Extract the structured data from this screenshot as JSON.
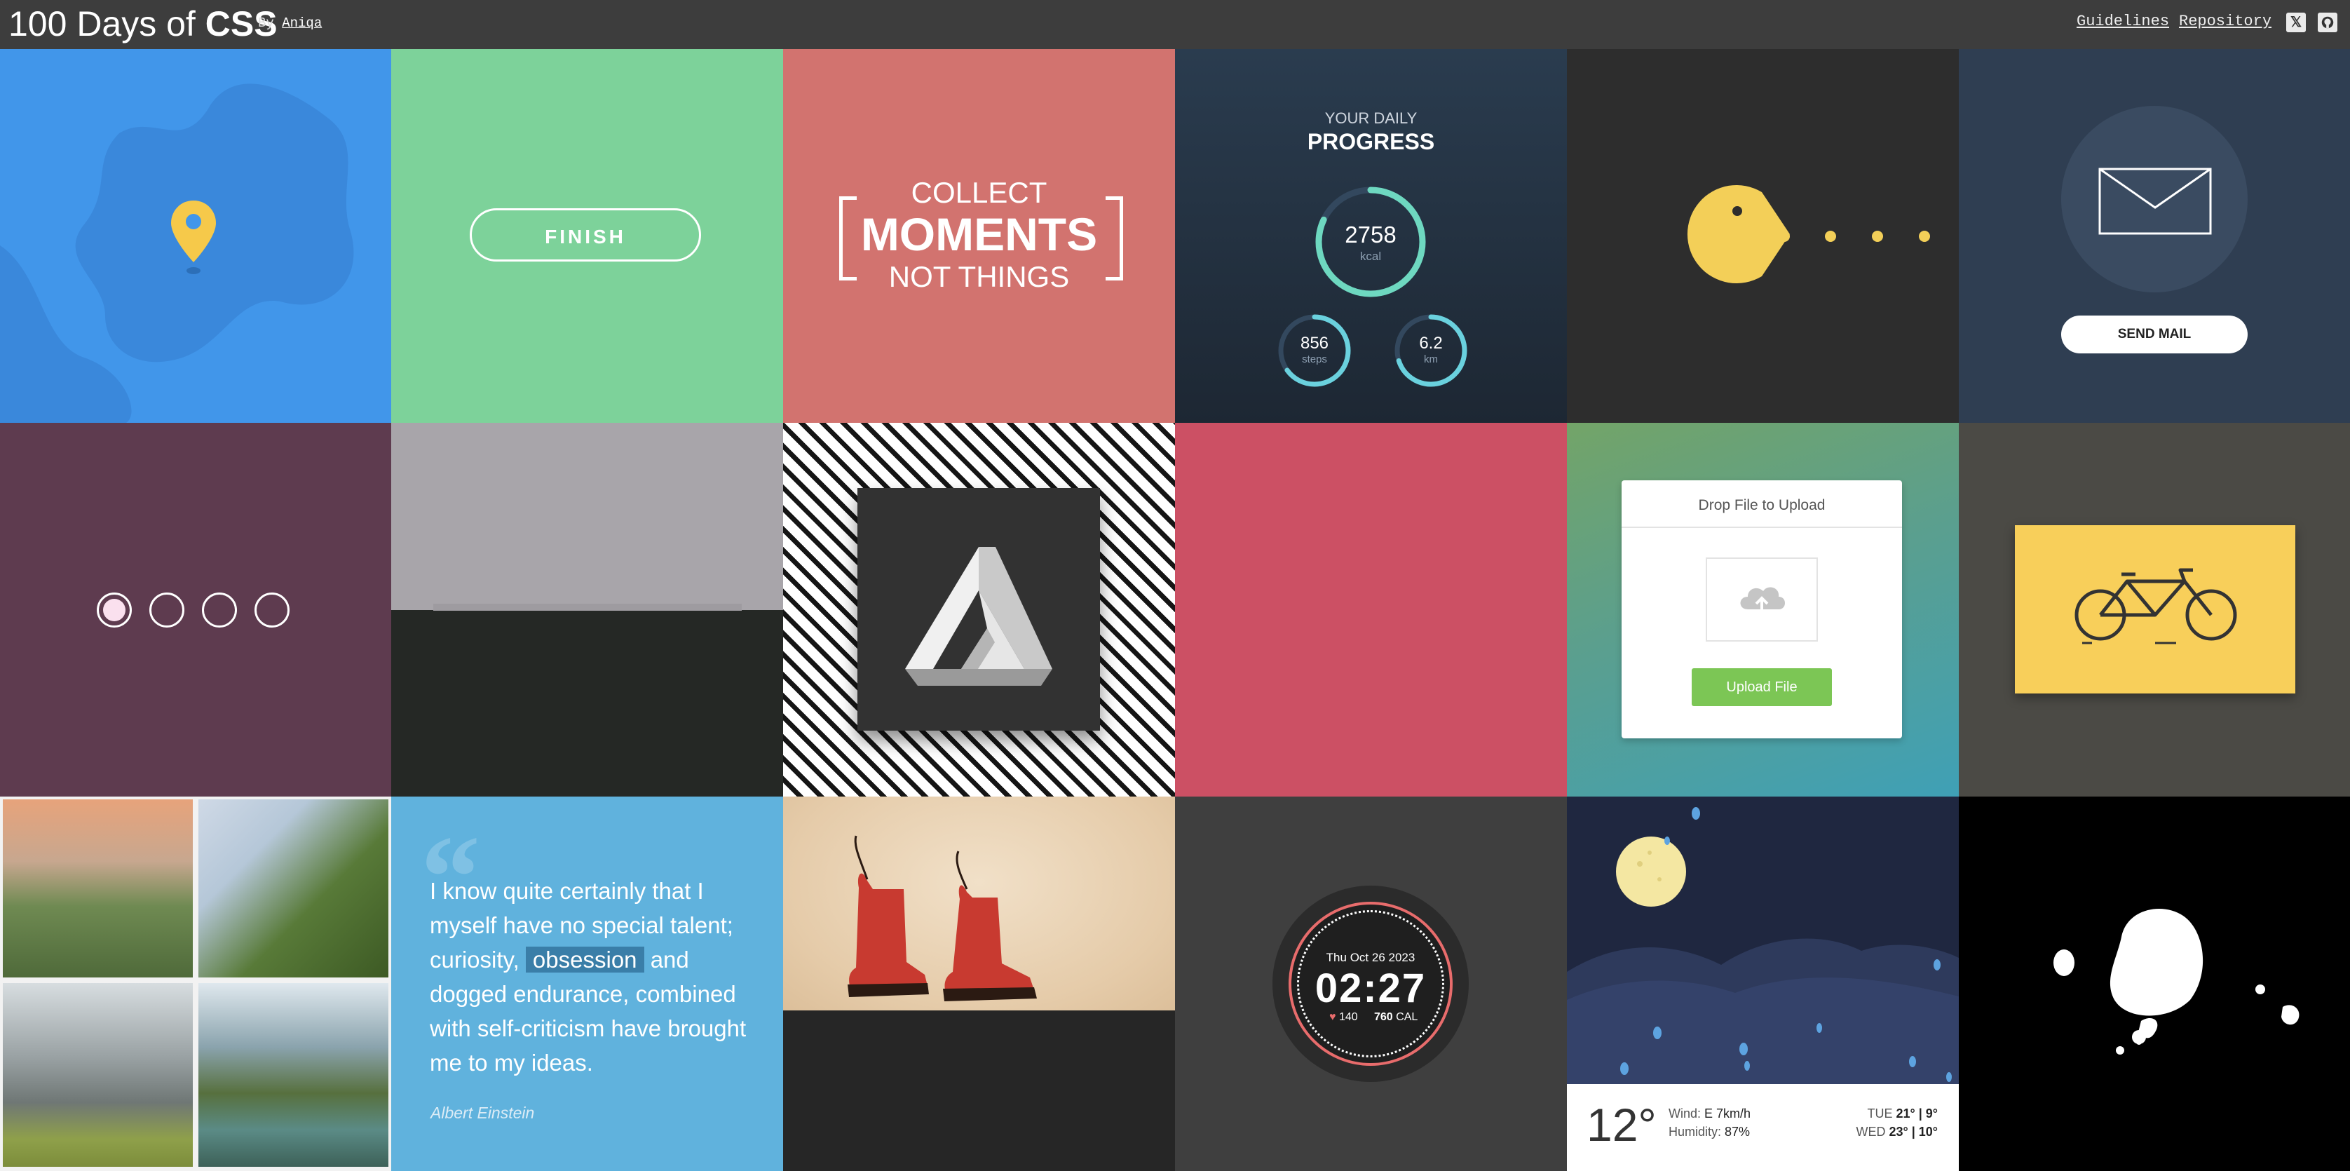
{
  "header": {
    "title_prefix": "100 Days of",
    "title_strong": "CSS",
    "by_label": "By",
    "author": "Aniqa",
    "nav": [
      "Guidelines",
      "Repository"
    ],
    "icons": [
      "x-twitter-icon",
      "github-icon"
    ]
  },
  "tiles": {
    "finish": {
      "button_label": "FINISH"
    },
    "collect": {
      "line1": "COLLECT",
      "line2": "MOMENTS",
      "line3": "NOT THINGS"
    },
    "progress": {
      "kicker": "YOUR DAILY",
      "title": "PROGRESS",
      "main_value": "2758",
      "main_unit": "kcal",
      "main_fill": 0.82,
      "steps_value": "856",
      "steps_unit": "steps",
      "steps_fill": 0.65,
      "km_value": "6.2",
      "km_unit": "km",
      "km_fill": 0.7
    },
    "mail": {
      "button_label": "SEND MAIL"
    },
    "upload": {
      "title": "Drop File to Upload",
      "button_label": "Upload File"
    },
    "quote": {
      "before": "I know quite certainly that I myself have no special talent; curiosity,",
      "highlight": "obsession",
      "after": "and dogged endurance, combined with self-criticism have brought me to my ideas.",
      "author": "Albert Einstein"
    },
    "watch": {
      "date": "Thu Oct 26 2023",
      "time": "02:27",
      "heart": "140",
      "cal_value": "760",
      "cal_unit": "CAL"
    },
    "weather": {
      "temp": "12°",
      "wind_label": "Wind:",
      "wind_value": "E 7km/h",
      "humidity_label": "Humidity:",
      "humidity_value": "87%",
      "day1": "TUE",
      "day1_temps": "21° | 9°",
      "day2": "WED",
      "day2_temps": "23° | 10°"
    }
  },
  "colors": {
    "map_blue": "#4196ea",
    "green": "#7dd29a",
    "salmon": "#d2736f",
    "navy": "#283a4d",
    "dark": "#2d2d2d",
    "mail_bg": "#2f3e52",
    "plum": "#5e3b4f",
    "crimson": "#cc5064",
    "bike_yellow": "#f8cf5a",
    "quote_blue": "#60b2dd",
    "sky": "#1f2740",
    "accent_teal": "#6ed8c0"
  }
}
